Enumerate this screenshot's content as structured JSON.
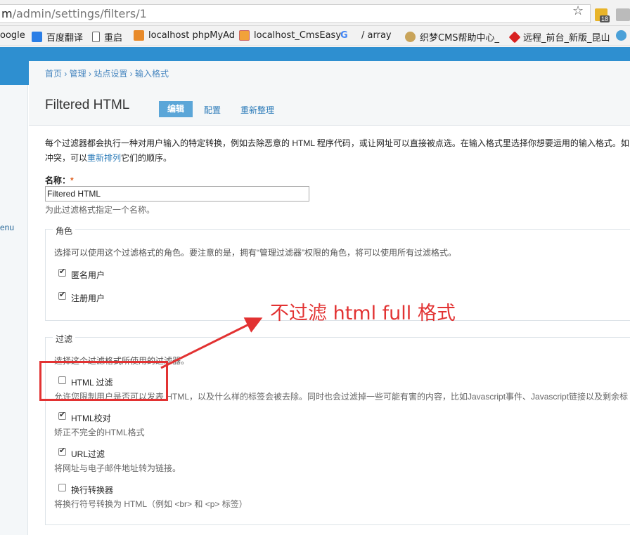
{
  "browser": {
    "url_prefix": "m",
    "url_path": "/admin/settings/filters/1",
    "ext_badge": "18"
  },
  "bookmarks": [
    {
      "label": "oogle"
    },
    {
      "label": "百度翻译"
    },
    {
      "label": "重启"
    },
    {
      "label": "localhost phpMyAd"
    },
    {
      "label": "localhost_CmsEasy"
    },
    {
      "label": "/ array"
    },
    {
      "label": "织梦CMS帮助中心_"
    },
    {
      "label": "远程_前台_新版_昆山"
    }
  ],
  "sidebar": {
    "menu_fragment": "enu"
  },
  "breadcrumb": "首页 › 管理 › 站点设置 › 输入格式",
  "page": {
    "title": "Filtered HTML",
    "tabs": [
      "编辑",
      "配置",
      "重新整理"
    ],
    "description_1": "每个过滤器都会执行一种对用户输入的特定转换，例如去除恶意的 HTML 程序代码，或让网址可以直接被点选。在输入格式里选择你想要运用的输入格式。如",
    "description_2": "冲突，可以",
    "description_link": "重新排列",
    "description_3": "它们的顺序。"
  },
  "name_field": {
    "label": "名称：",
    "required_mark": "*",
    "value": "Filtered HTML",
    "hint": "为此过滤格式指定一个名称。"
  },
  "roles": {
    "legend": "角色",
    "description": "选择可以使用这个过滤格式的角色。要注意的是，拥有“管理过滤器”权限的角色，将可以使用所有过滤格式。",
    "items": [
      {
        "label": "匿名用户",
        "checked": true
      },
      {
        "label": "注册用户",
        "checked": true
      }
    ]
  },
  "filters": {
    "legend": "过滤",
    "description": "选择这个过滤格式所使用的过滤器。",
    "items": [
      {
        "label": "HTML 过滤",
        "checked": false,
        "hint": "允许您限制用户是否可以发表 HTML，以及什么样的标签会被去除。同时也会过滤掉一些可能有害的内容，比如Javascript事件、Javascript链接以及剩余标"
      },
      {
        "label": "HTML校对",
        "checked": true,
        "hint": "矫正不完全的HTML格式"
      },
      {
        "label": "URL过滤",
        "checked": true,
        "hint": "将网址与电子邮件地址转为链接。"
      },
      {
        "label": "换行转换器",
        "checked": false,
        "hint": "将换行符号转换为 HTML（例如 <br> 和 <p> 标签）"
      }
    ]
  },
  "annotation": {
    "text": "不过滤 html full 格式",
    "color": "#e23232"
  }
}
